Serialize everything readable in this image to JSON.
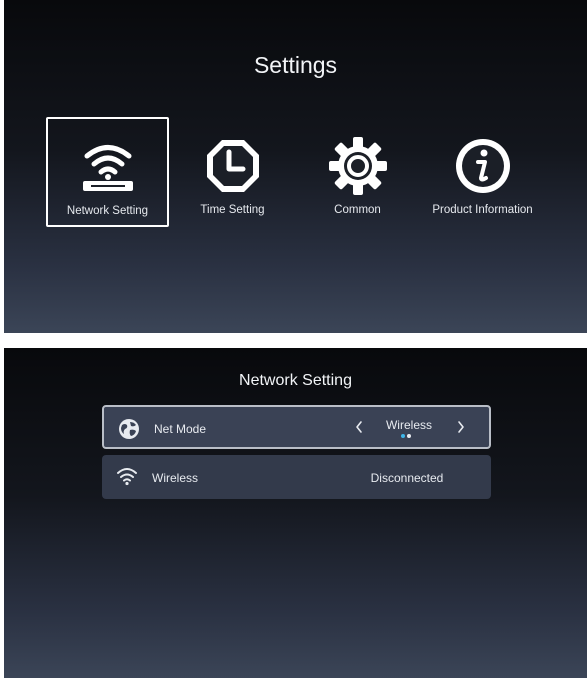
{
  "settings_screen": {
    "title": "Settings",
    "tiles": [
      {
        "label": "Network Setting",
        "icon": "wifi-router-icon",
        "selected": true
      },
      {
        "label": "Time Setting",
        "icon": "clock-icon",
        "selected": false
      },
      {
        "label": "Common",
        "icon": "gear-icon",
        "selected": false
      },
      {
        "label": "Product Information",
        "icon": "info-icon",
        "selected": false
      }
    ]
  },
  "network_screen": {
    "title": "Network Setting",
    "rows": [
      {
        "label": "Net Mode",
        "icon": "globe-icon",
        "value": "Wireless",
        "focused": true
      },
      {
        "label": "Wireless",
        "icon": "wifi-icon",
        "value": "Disconnected",
        "focused": false
      }
    ],
    "option_indicator": {
      "count": 2,
      "active_index": 0
    }
  },
  "colors": {
    "accent": "#3fb6e8",
    "focus_border": "#ffffff",
    "text": "#e8ebf0"
  }
}
